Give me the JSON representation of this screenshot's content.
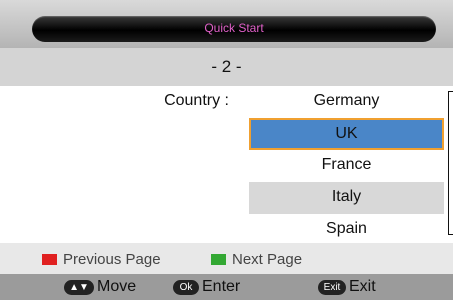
{
  "header": {
    "title": "Quick Start"
  },
  "page": {
    "number": "- 2 -"
  },
  "country": {
    "label": "Country :",
    "options": [
      "Germany",
      "UK",
      "France",
      "Italy",
      "Spain"
    ],
    "selected": "UK"
  },
  "legend": {
    "previous": {
      "label": "Previous Page",
      "color": "#e02020"
    },
    "next": {
      "label": "Next Page",
      "color": "#33a833"
    }
  },
  "help": {
    "move": {
      "key": "▲▼",
      "label": "Move"
    },
    "enter": {
      "key": "Ok",
      "label": "Enter"
    },
    "exit": {
      "key": "Exit",
      "label": "Exit"
    }
  }
}
